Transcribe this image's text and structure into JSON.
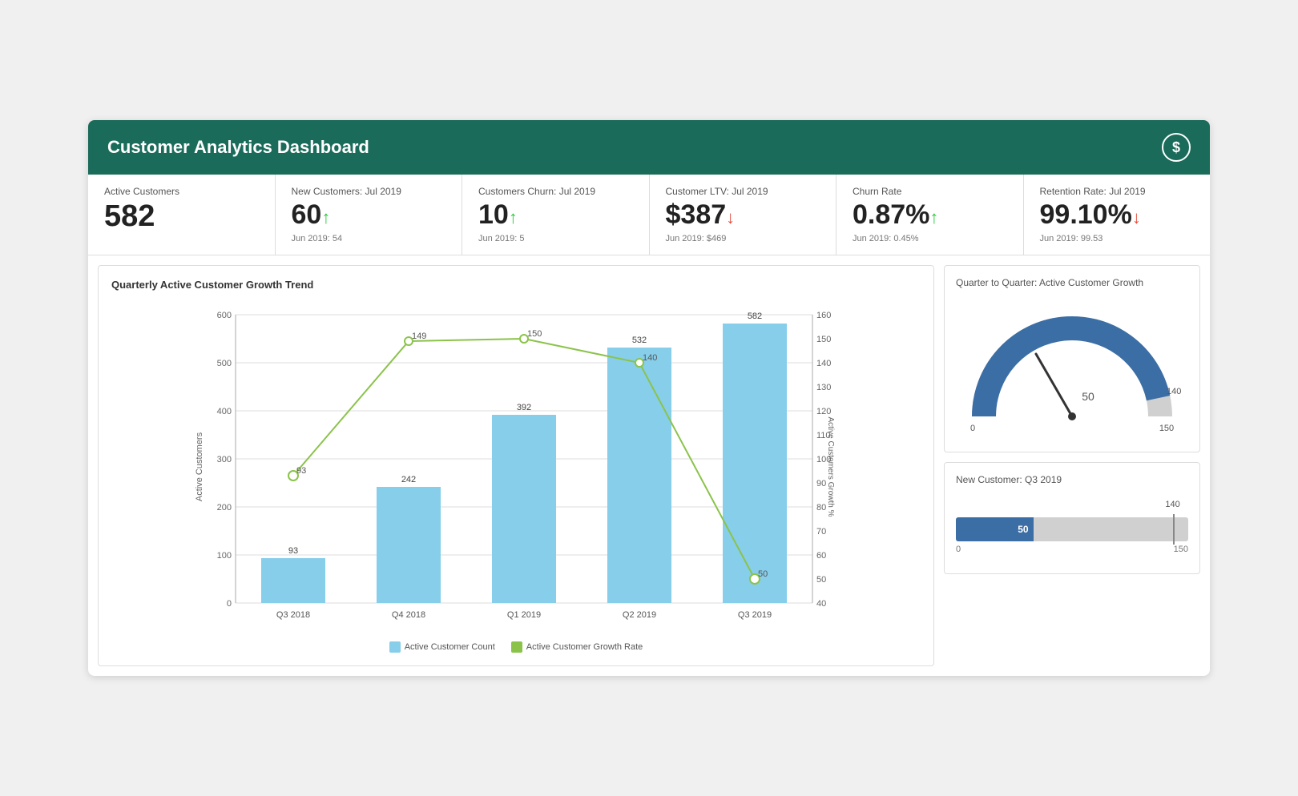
{
  "header": {
    "title": "Customer Analytics Dashboard",
    "icon": "$"
  },
  "kpis": [
    {
      "label": "Active Customers",
      "value": "582",
      "arrow": null,
      "sub": null
    },
    {
      "label": "New Customers: Jul 2019",
      "value": "60",
      "arrow": "up",
      "sub": "Jun 2019: 54"
    },
    {
      "label": "Customers Churn: Jul 2019",
      "value": "10",
      "arrow": "up",
      "sub": "Jun 2019: 5"
    },
    {
      "label": "Customer LTV: Jul 2019",
      "value": "$387",
      "arrow": "down",
      "sub": "Jun 2019: $469"
    },
    {
      "label": "Churn Rate",
      "value": "0.87%",
      "arrow": "up",
      "sub": "Jun 2019: 0.45%"
    },
    {
      "label": "Retention Rate: Jul 2019",
      "value": "99.10%",
      "arrow": "down",
      "sub": "Jun 2019: 99.53"
    }
  ],
  "bar_chart": {
    "title": "Quarterly Active Customer Growth Trend",
    "y_label": "Active Customers",
    "y2_label": "Active Customers Growth %",
    "bars": [
      {
        "label": "Q3 2018",
        "count": 93,
        "growth": 93
      },
      {
        "label": "Q4 2018",
        "count": 242,
        "growth": 149
      },
      {
        "label": "Q1 2019",
        "count": 392,
        "growth": 150
      },
      {
        "label": "Q2 2019",
        "count": 532,
        "growth": 140
      },
      {
        "label": "Q3 2019",
        "count": 582,
        "growth": 50
      }
    ],
    "legend_bar": "Active Customer Count",
    "legend_line": "Active Customer Growth Rate"
  },
  "gauge": {
    "title": "Quarter to Quarter: Active Customer Growth",
    "value": 50,
    "min": 0,
    "max": 150,
    "marker": 140,
    "label_50": "50",
    "label_140": "140",
    "label_0": "0",
    "label_150": "150"
  },
  "hbar": {
    "title": "New Customer: Q3 2019",
    "value": 50,
    "marker": 140,
    "min": 0,
    "max": 150,
    "label_value": "50",
    "label_marker": "140",
    "label_min": "0",
    "label_max": "150"
  }
}
